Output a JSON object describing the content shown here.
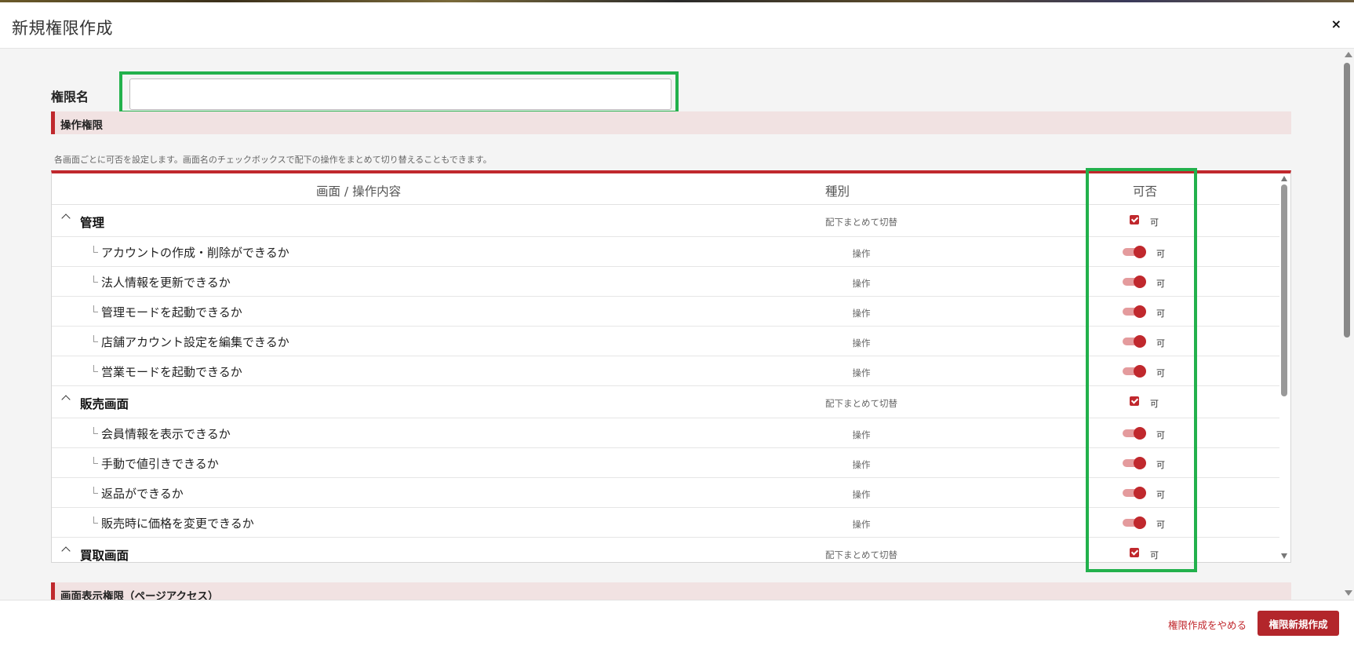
{
  "modal": {
    "title": "新規権限作成",
    "close_label": "×"
  },
  "form": {
    "name_label": "権限名",
    "name_value": "",
    "name_placeholder": ""
  },
  "operation_section": {
    "title": "操作権限",
    "helper": "各画面ごとに可否を設定します。画面名のチェックボックスで配下の操作をまとめて切り替えることもできます。",
    "columns": [
      "画面 / 操作内容",
      "種別",
      "可否"
    ],
    "rows": [
      {
        "kind": "group",
        "name": "管理",
        "type": "配下まとめて切替",
        "allow": "可",
        "checked": true
      },
      {
        "kind": "item",
        "name": "アカウントの作成・削除ができるか",
        "type": "操作",
        "allow": "可",
        "on": true
      },
      {
        "kind": "item",
        "name": "法人情報を更新できるか",
        "type": "操作",
        "allow": "可",
        "on": true
      },
      {
        "kind": "item",
        "name": "管理モードを起動できるか",
        "type": "操作",
        "allow": "可",
        "on": true
      },
      {
        "kind": "item",
        "name": "店舗アカウント設定を編集できるか",
        "type": "操作",
        "allow": "可",
        "on": true
      },
      {
        "kind": "item",
        "name": "営業モードを起動できるか",
        "type": "操作",
        "allow": "可",
        "on": true
      },
      {
        "kind": "group",
        "name": "販売画面",
        "type": "配下まとめて切替",
        "allow": "可",
        "checked": true
      },
      {
        "kind": "item",
        "name": "会員情報を表示できるか",
        "type": "操作",
        "allow": "可",
        "on": true
      },
      {
        "kind": "item",
        "name": "手動で値引きできるか",
        "type": "操作",
        "allow": "可",
        "on": true
      },
      {
        "kind": "item",
        "name": "返品ができるか",
        "type": "操作",
        "allow": "可",
        "on": true
      },
      {
        "kind": "item",
        "name": "販売時に価格を変更できるか",
        "type": "操作",
        "allow": "可",
        "on": true
      },
      {
        "kind": "group",
        "name": "買取画面",
        "type": "配下まとめて切替",
        "allow": "可",
        "checked": true
      }
    ]
  },
  "page_section": {
    "title": "画面表示権限（ページアクセス）"
  },
  "footer": {
    "cancel_label": "権限作成をやめる",
    "create_label": "権限新規作成"
  },
  "colors": {
    "accent": "#c0282d",
    "highlight": "#22b14c",
    "section_bg": "#f1e2e2"
  }
}
